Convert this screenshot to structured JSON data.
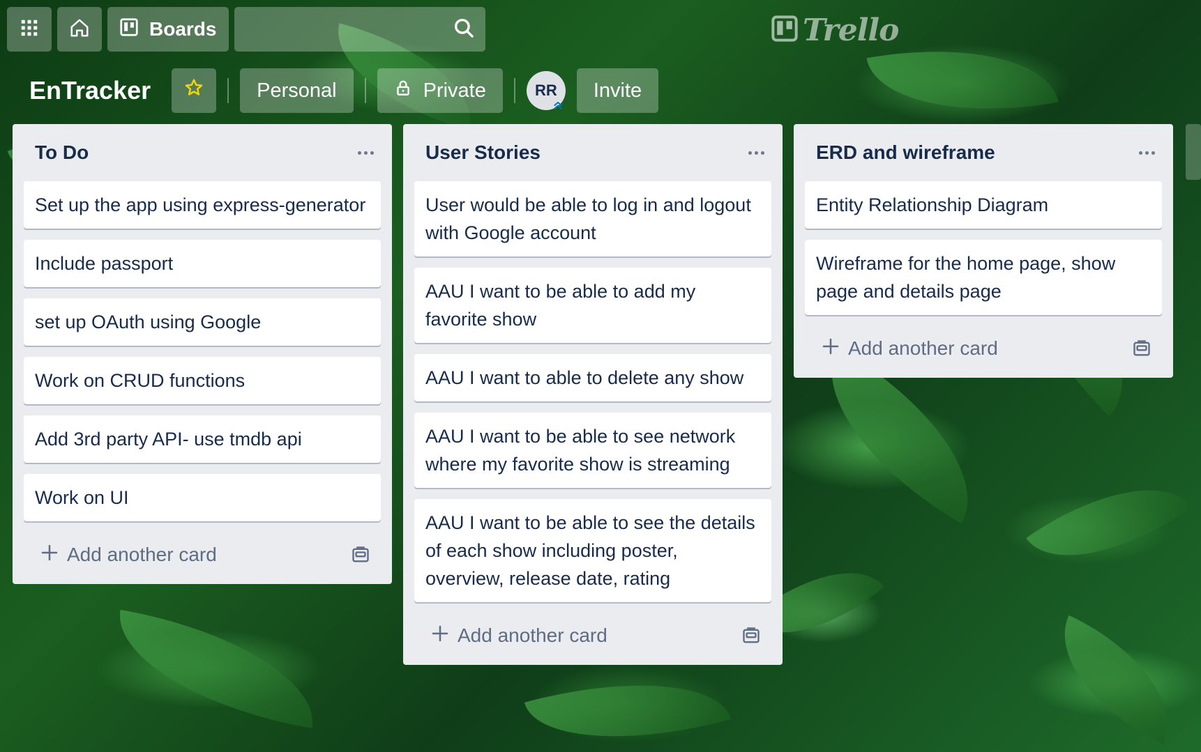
{
  "topbar": {
    "apps_icon": "grid-icon",
    "home_icon": "home-icon",
    "boards_label": "Boards",
    "search_placeholder": "",
    "logo_text": "Trello"
  },
  "board": {
    "title": "EnTracker",
    "visibility_workspace": "Personal",
    "visibility": "Private",
    "member_initials": "RR",
    "invite_label": "Invite"
  },
  "lists": [
    {
      "title": "To Do",
      "cards": [
        "Set up the app using express-generator",
        "Include passport",
        "set up OAuth using Google",
        "Work on CRUD functions",
        "Add 3rd party API- use tmdb api",
        "Work on UI"
      ],
      "add_label": "Add another card"
    },
    {
      "title": "User Stories",
      "cards": [
        "User would be able to log in and logout with Google account",
        "AAU I want to be able to add my favorite show",
        "AAU I want to able to delete any show",
        "AAU I want to be able to see network where my favorite show is streaming",
        "AAU I want to be able to see the details of each show including poster, overview, release date, rating"
      ],
      "add_label": "Add another card"
    },
    {
      "title": "ERD and wireframe",
      "cards": [
        "Entity Relationship Diagram",
        "Wireframe for the home page, show page and details page"
      ],
      "add_label": "Add another card"
    }
  ],
  "colors": {
    "list_bg": "#ebecf0",
    "card_text": "#172b4d",
    "star": "#f2d600",
    "muted": "#5e6c84"
  }
}
